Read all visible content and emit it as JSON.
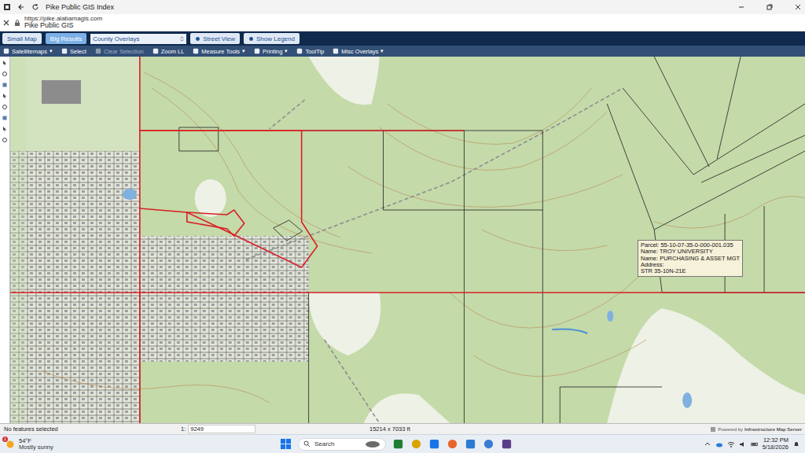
{
  "browser": {
    "title": "Pike Public GIS Index",
    "url": "https://pike.alabamagis.com",
    "site": "Pike Public GIS"
  },
  "toolbar": {
    "buttons": [
      {
        "label": "Small Map",
        "selected": false
      },
      {
        "label": "Big Results",
        "selected": true
      }
    ],
    "dropdown": {
      "label": "County Overlays"
    },
    "actions": [
      "Street View",
      "Show Legend"
    ]
  },
  "menu_arrow": "▾",
  "tools": [
    {
      "label": "Satellitemaps",
      "menu": true,
      "disabled": false
    },
    {
      "label": "Select",
      "menu": false,
      "disabled": false
    },
    {
      "label": "Clear Selection",
      "menu": false,
      "disabled": true
    },
    {
      "label": "Zoom LL",
      "menu": false,
      "disabled": false
    },
    {
      "label": "Measure Tools",
      "menu": true,
      "disabled": false
    },
    {
      "label": "Printing",
      "menu": true,
      "disabled": false
    },
    {
      "label": "ToolTip",
      "menu": false,
      "disabled": false
    },
    {
      "label": "Misc Overlays",
      "menu": true,
      "disabled": false
    }
  ],
  "tooltip": {
    "lines": [
      "Parcel: 55-10-07-35-0-000-001.035",
      "Name: TROY UNIVERSITY",
      "Name: PURCHASING & ASSET MGT",
      "Address:",
      "STR 35-10N-21E"
    ]
  },
  "status_bar": {
    "message": "No features selected",
    "scale_label": "1:",
    "scale": "9249",
    "extent": "15214 x 7033 ft",
    "credit_small": "Powered by",
    "credit": "Infrastructure Map Server"
  },
  "taskbar": {
    "weather": {
      "badge": "1",
      "temp": "54°F",
      "condition": "Mostly sunny"
    },
    "search": {
      "placeholder": "Search"
    },
    "time": "12:32 PM",
    "date": "5/18/2026"
  }
}
